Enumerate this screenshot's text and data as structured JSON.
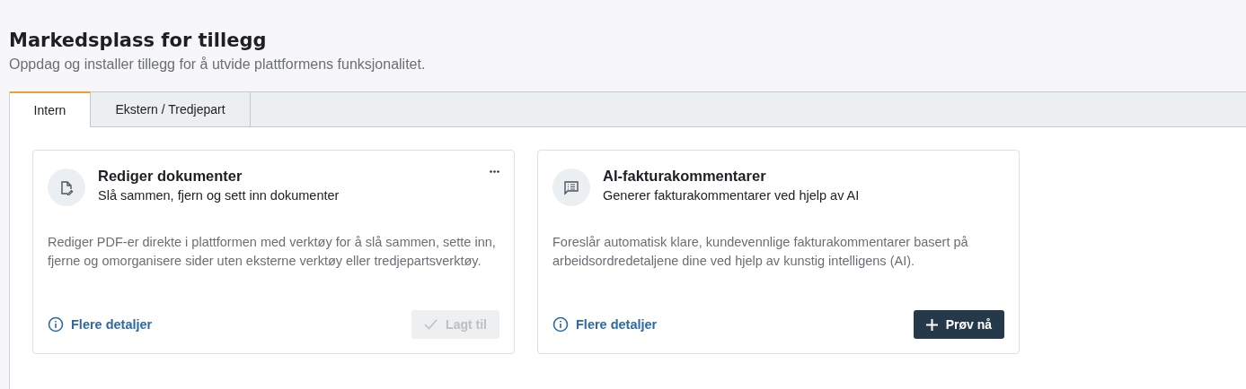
{
  "header": {
    "title": "Markedsplass for tillegg",
    "subtitle": "Oppdag og installer tillegg for å utvide plattformens funksjonalitet."
  },
  "tabs": [
    {
      "label": "Intern",
      "selected": true
    },
    {
      "label": "Ekstern / Tredjepart",
      "selected": false
    }
  ],
  "cards": [
    {
      "title": "Rediger dokumenter",
      "subtitle": "Slå sammen, fjern og sett inn dokumenter",
      "menu": true,
      "description": "Rediger PDF-er direkte i plattformen med verktøy for å slå sammen, sette inn, fjerne og omorganisere sider uten eksterne verktøy eller tredjepartsverktøy.",
      "details_link": "Flere detaljer",
      "action": {
        "kind": "added",
        "label": "Lagt til",
        "disabled": true
      }
    },
    {
      "title": "AI-fakturakommentarer",
      "subtitle": "Generer fakturakommentarer ved hjelp av AI",
      "menu": false,
      "description": "Foreslår automatisk klare, kundevennlige fakturakommentarer basert på arbeidsordredetaljene dine ved hjelp av kunstig intelligens (AI).",
      "details_link": "Flere detaljer",
      "action": {
        "kind": "try",
        "label": "Prøv nå",
        "disabled": false
      }
    }
  ]
}
